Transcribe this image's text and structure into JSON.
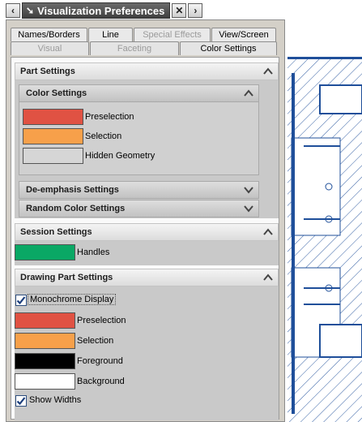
{
  "window": {
    "title": "Visualization Preferences",
    "back_icon": "chevron-left-icon",
    "collapse_icon": "diagonal-arrow-icon",
    "close_icon": "close-icon",
    "forward_icon": "chevron-right-icon"
  },
  "tabs": {
    "row1": [
      "Names/Borders",
      "Line",
      "Special Effects",
      "View/Screen"
    ],
    "row2": [
      "Visual",
      "Faceting",
      "Color Settings"
    ],
    "active": "Color Settings",
    "disabled": [
      "Special Effects",
      "Visual",
      "Faceting"
    ]
  },
  "part_settings": {
    "title": "Part Settings",
    "color_settings": {
      "title": "Color Settings",
      "items": [
        {
          "label": "Preselection",
          "color": "#e05243"
        },
        {
          "label": "Selection",
          "color": "#f7a04a"
        },
        {
          "label": "Hidden Geometry",
          "color": "#d6d6d6"
        }
      ]
    },
    "deemphasis": {
      "title": "De-emphasis Settings"
    },
    "random_color": {
      "title": "Random Color Settings"
    }
  },
  "session_settings": {
    "title": "Session Settings",
    "items": [
      {
        "label": "Handles",
        "color": "#0aa865"
      }
    ]
  },
  "drawing_part_settings": {
    "title": "Drawing Part Settings",
    "monochrome_label": "Monochrome Display",
    "monochrome_checked": true,
    "items": [
      {
        "label": "Preselection",
        "color": "#e05243"
      },
      {
        "label": "Selection",
        "color": "#f7a04a"
      },
      {
        "label": "Foreground",
        "color": "#000000"
      },
      {
        "label": "Background",
        "color": "#ffffff"
      }
    ],
    "show_widths_label": "Show Widths",
    "show_widths_checked": true
  },
  "colors": {
    "cad_line": "#1f4f9a",
    "accent": "#2f6bbf"
  }
}
